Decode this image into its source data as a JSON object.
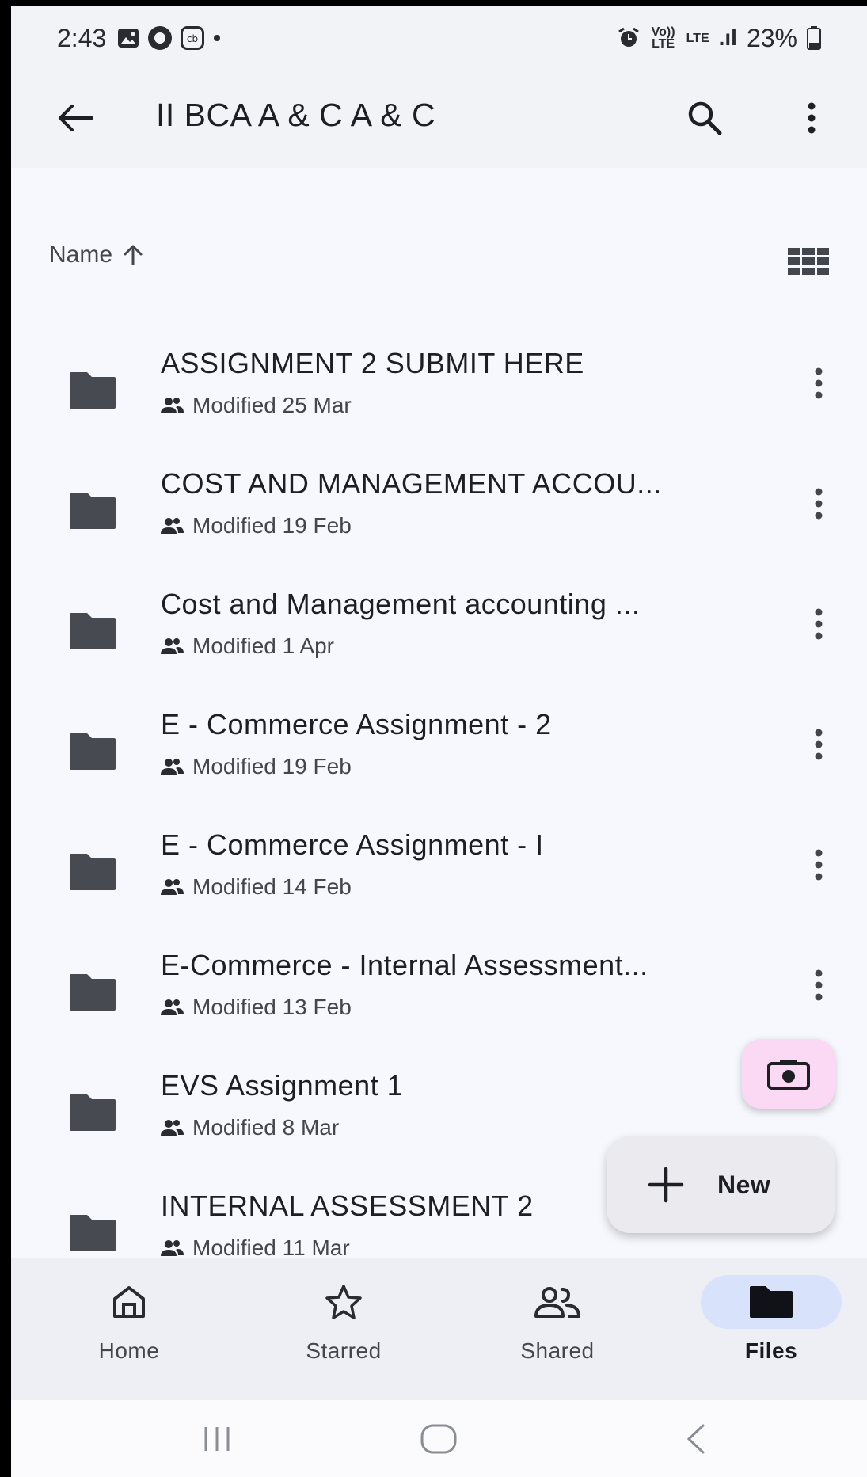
{
  "status_bar": {
    "time": "2:43",
    "notification_icons": [
      "image-icon",
      "circle-icon",
      "cb-icon",
      "dot-icon"
    ],
    "volte_label": "Vo)) LTE",
    "lte_label": "LTE",
    "signal_label": ".ıl",
    "battery_percent": "23%"
  },
  "app_bar": {
    "title": "II BCA A & C A & C"
  },
  "sort": {
    "label": "Name"
  },
  "files": [
    {
      "name": "ASSIGNMENT 2 SUBMIT HERE",
      "modified": "Modified 25 Mar"
    },
    {
      "name": "COST AND MANAGEMENT ACCOU...",
      "modified": "Modified 19 Feb"
    },
    {
      "name": "Cost and Management accounting ...",
      "modified": "Modified 1 Apr"
    },
    {
      "name": "E - Commerce Assignment - 2",
      "modified": "Modified 19 Feb"
    },
    {
      "name": "E - Commerce Assignment - I",
      "modified": "Modified 14 Feb"
    },
    {
      "name": "E-Commerce - Internal Assessment...",
      "modified": "Modified 13 Feb"
    },
    {
      "name": "EVS Assignment 1",
      "modified": "Modified 8 Mar"
    },
    {
      "name": "INTERNAL ASSESSMENT 2",
      "modified": "Modified 11 Mar"
    }
  ],
  "fab": {
    "new_label": "New"
  },
  "bottom_nav": {
    "items": [
      {
        "label": "Home",
        "icon": "home-icon",
        "active": false
      },
      {
        "label": "Starred",
        "icon": "star-icon",
        "active": false
      },
      {
        "label": "Shared",
        "icon": "shared-icon",
        "active": false
      },
      {
        "label": "Files",
        "icon": "folder-icon",
        "active": true
      }
    ]
  },
  "colors": {
    "background": "#f7f8fd",
    "app_bar": "#f2f3f7",
    "folder": "#474a51",
    "camera_fab": "#fbd8f4",
    "new_fab": "#eaeaef",
    "nav_active_pill": "#d8e2fb"
  }
}
